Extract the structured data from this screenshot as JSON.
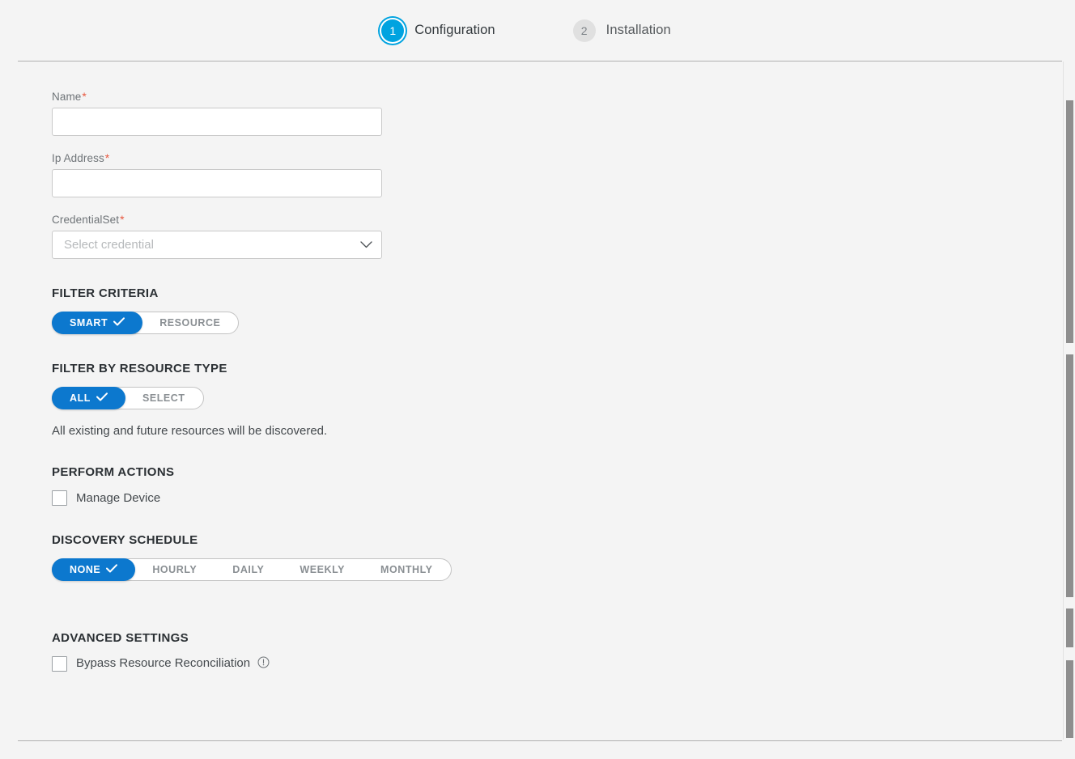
{
  "stepper": {
    "steps": [
      {
        "number": "1",
        "label": "Configuration",
        "state": "active"
      },
      {
        "number": "2",
        "label": "Installation",
        "state": "inactive"
      }
    ]
  },
  "form": {
    "name_field": {
      "label": "Name",
      "required_marker": "*",
      "value": "",
      "placeholder": ""
    },
    "ip_field": {
      "label": "Ip Address",
      "required_marker": "*",
      "value": "",
      "placeholder": ""
    },
    "credential_field": {
      "label": "CredentialSet",
      "required_marker": "*",
      "selected": "Select credential",
      "icon": "chevron-down-icon"
    }
  },
  "filter_criteria": {
    "title": "FILTER CRITERIA",
    "options": [
      {
        "label": "SMART",
        "selected": true
      },
      {
        "label": "RESOURCE",
        "selected": false
      }
    ]
  },
  "filter_by_resource_type": {
    "title": "FILTER BY RESOURCE TYPE",
    "options": [
      {
        "label": "ALL",
        "selected": true
      },
      {
        "label": "SELECT",
        "selected": false
      }
    ],
    "helper_text": "All existing and future resources will be discovered."
  },
  "perform_actions": {
    "title": "PERFORM ACTIONS",
    "checkbox": {
      "label": "Manage Device",
      "checked": false
    }
  },
  "discovery_schedule": {
    "title": "DISCOVERY SCHEDULE",
    "options": [
      {
        "label": "NONE",
        "selected": true
      },
      {
        "label": "HOURLY",
        "selected": false
      },
      {
        "label": "DAILY",
        "selected": false
      },
      {
        "label": "WEEKLY",
        "selected": false
      },
      {
        "label": "MONTHLY",
        "selected": false
      }
    ]
  },
  "advanced_settings": {
    "title": "ADVANCED SETTINGS",
    "checkbox": {
      "label": "Bypass Resource Reconciliation",
      "checked": false
    },
    "info_icon": "info-circle-icon"
  },
  "colors": {
    "primary_blue": "#0c78ce",
    "step_active": "#00a3e0",
    "required_asterisk": "#e8573f",
    "page_background": "#f4f4f4"
  }
}
